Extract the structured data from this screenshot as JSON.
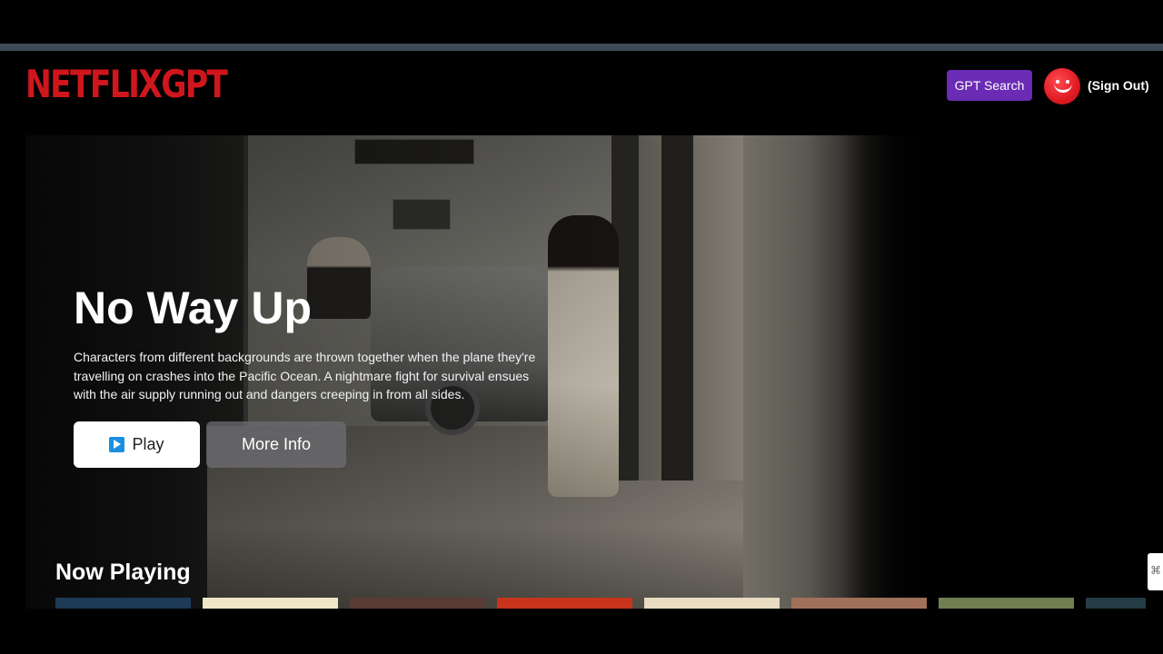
{
  "header": {
    "logo_text": "NETFLIXGPT",
    "gpt_search_label": "GPT Search",
    "sign_out_label": "(Sign Out)",
    "brand_color": "#d0161d",
    "gpt_button_color": "#6b2bb5"
  },
  "hero": {
    "title": "No Way Up",
    "overview": "Characters from different backgrounds are thrown together when the plane they're travelling on crashes into the Pacific Ocean. A nightmare fight for survival ensues with the air supply running out and dangers creeping in from all sides.",
    "play_label": "Play",
    "more_info_label": "More Info",
    "play_icon": "play-icon"
  },
  "now_playing": {
    "title": "Now Playing",
    "posters": [
      {
        "color": "#1d3a56"
      },
      {
        "color": "#efe6c6"
      },
      {
        "color": "#5a3a34"
      },
      {
        "color": "#c8341c"
      },
      {
        "color": "#e9dcc3"
      },
      {
        "color": "#a1705a"
      },
      {
        "color": "#6f7f52"
      },
      {
        "color": "#243c44"
      }
    ]
  }
}
